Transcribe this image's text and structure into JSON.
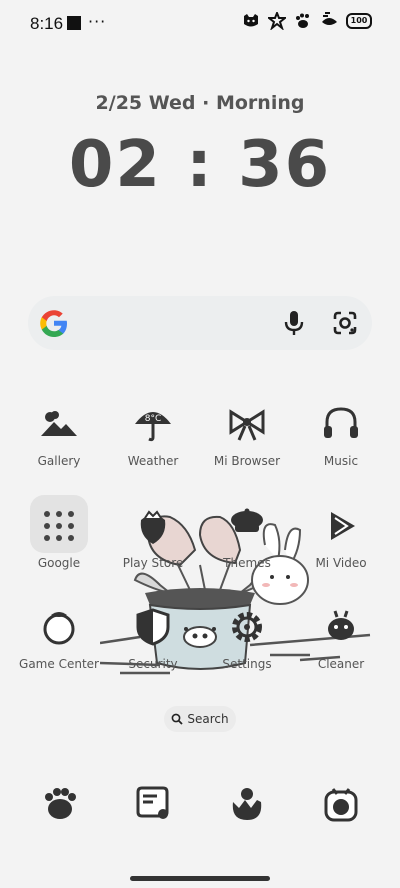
{
  "status_bar": {
    "time": "8:16",
    "dots": "···",
    "battery": "100",
    "icons": [
      "cat-face-icon",
      "sparkle-icon",
      "paw-icon",
      "wifi-fish-icon",
      "battery-icon"
    ]
  },
  "clock": {
    "date": "2/25 Wed · Morning",
    "time": "02 : 36"
  },
  "search_widget": {
    "icons": [
      "google-logo-icon",
      "microphone-icon",
      "google-lens-icon"
    ]
  },
  "apps": [
    {
      "label": "Gallery",
      "icon": "mountain-cloud-icon"
    },
    {
      "label": "Weather",
      "icon": "umbrella-icon",
      "temp": "8°C"
    },
    {
      "label": "Mi Browser",
      "icon": "bow-icon"
    },
    {
      "label": "Music",
      "icon": "headphones-icon"
    },
    {
      "label": "Google",
      "icon": "folder-icon"
    },
    {
      "label": "Play Store",
      "icon": "strawberry-icon"
    },
    {
      "label": "Themes",
      "icon": "beret-icon"
    },
    {
      "label": "Mi Video",
      "icon": "play-icon"
    },
    {
      "label": "Game Center",
      "icon": "tomato-icon"
    },
    {
      "label": "Security",
      "icon": "shield-icon"
    },
    {
      "label": "Settings",
      "icon": "gear-icon"
    },
    {
      "label": "Cleaner",
      "icon": "cleaner-bot-icon"
    }
  ],
  "search_pill": {
    "label": "Search",
    "icon": "search-icon"
  },
  "dock": [
    {
      "icon": "paw-phone-icon"
    },
    {
      "icon": "message-bubble-icon"
    },
    {
      "icon": "chick-icon"
    },
    {
      "icon": "camera-icon"
    }
  ]
}
